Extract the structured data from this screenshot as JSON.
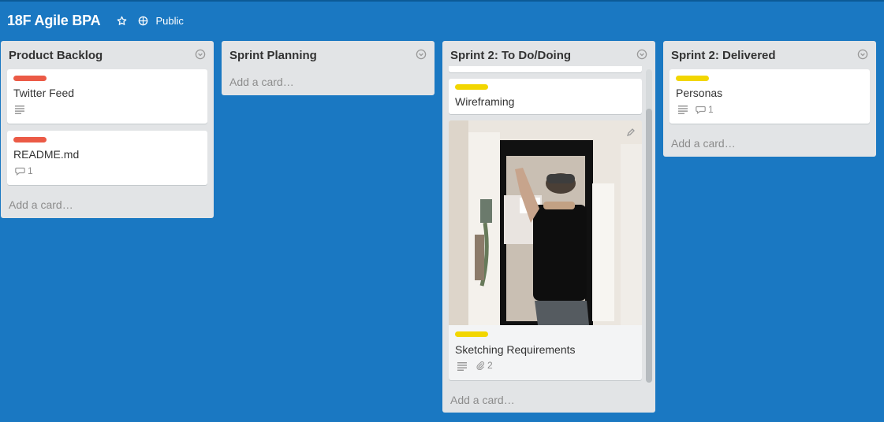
{
  "board": {
    "title": "18F Agile BPA",
    "star_icon": "star-icon",
    "visibility": "Public",
    "visibility_icon": "globe-icon"
  },
  "lists": [
    {
      "title": "Product Backlog",
      "cards": [
        {
          "label": "red",
          "title": "Twitter Feed",
          "badges": {
            "description": true
          }
        },
        {
          "label": "red",
          "title": "README.md",
          "badges": {
            "comments": "1"
          }
        }
      ],
      "add_card": "Add a card…"
    },
    {
      "title": "Sprint Planning",
      "cards": [],
      "add_card": "Add a card…"
    },
    {
      "title": "Sprint 2: To Do/Doing",
      "cards": [
        {
          "label": "yellow",
          "title": "Wireframing"
        },
        {
          "label": "yellow",
          "title": "Sketching Requirements",
          "cover_image": true,
          "badges": {
            "description": true,
            "attachments": "2"
          }
        }
      ],
      "add_card": "Add a card…"
    },
    {
      "title": "Sprint 2: Delivered",
      "cards": [
        {
          "label": "yellow",
          "title": "Personas",
          "badges": {
            "description": true,
            "comments": "1"
          }
        }
      ],
      "add_card": "Add a card…"
    }
  ],
  "colors": {
    "board_bg": "#1a78c2",
    "list_bg": "#e2e4e6",
    "label_red": "#eb5a46",
    "label_yellow": "#f2d600"
  }
}
